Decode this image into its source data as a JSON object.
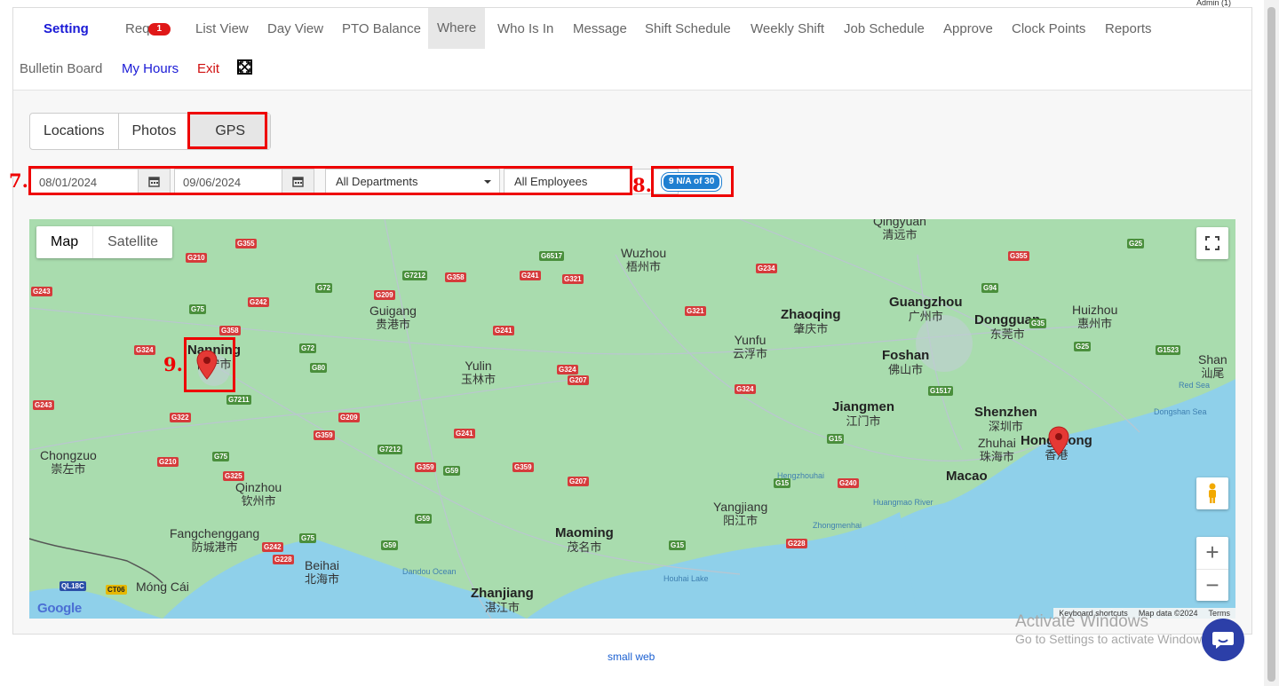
{
  "admin_label": "Admin (1)",
  "nav": {
    "row1": [
      {
        "label": "Setting",
        "style": "bold"
      },
      {
        "label": "Req",
        "badge": "1"
      },
      {
        "label": "List View"
      },
      {
        "label": "Day View"
      },
      {
        "label": "PTO Balance"
      },
      {
        "label": "Where",
        "style": "active"
      },
      {
        "label": "Who Is In"
      },
      {
        "label": "Message"
      },
      {
        "label": "Shift Schedule"
      },
      {
        "label": "Weekly Shift"
      },
      {
        "label": "Job Schedule"
      },
      {
        "label": "Approve"
      },
      {
        "label": "Clock Points"
      },
      {
        "label": "Reports"
      }
    ],
    "row2": [
      {
        "label": "Bulletin Board"
      },
      {
        "label": "My Hours",
        "style": "blue"
      },
      {
        "label": "Exit",
        "style": "red"
      }
    ],
    "expand_icon": "expand-icon"
  },
  "tabs": [
    {
      "label": "Locations"
    },
    {
      "label": "Photos"
    },
    {
      "label": "GPS",
      "active": true
    }
  ],
  "filters": {
    "start_date": "08/01/2024",
    "end_date": "09/06/2024",
    "department": "All Departments",
    "employee": "All Employees",
    "calendar_icon": "calendar-icon"
  },
  "count_badge": "9 N/A of 30",
  "annotations": {
    "filters": "7.",
    "count": "8.",
    "marker": "9."
  },
  "map": {
    "type_map": "Map",
    "type_satellite": "Satellite",
    "zoom_in": "+",
    "zoom_out": "−",
    "google": "Google",
    "footer": [
      "Keyboard shortcuts",
      "Map data ©2024",
      "Terms"
    ],
    "cities": [
      {
        "en": "Nanning",
        "zh": "南宁市"
      },
      {
        "en": "Wuzhou",
        "zh": "梧州市"
      },
      {
        "en": "Guigang",
        "zh": "贵港市"
      },
      {
        "en": "Yulin",
        "zh": "玉林市"
      },
      {
        "en": "Zhaoqing",
        "zh": "肇庆市"
      },
      {
        "en": "Guangzhou",
        "zh": "广州市"
      },
      {
        "en": "Dongguan",
        "zh": "东莞市"
      },
      {
        "en": "Huizhou",
        "zh": "惠州市"
      },
      {
        "en": "Yunfu",
        "zh": "云浮市"
      },
      {
        "en": "Foshan",
        "zh": "佛山市"
      },
      {
        "en": "Jiangmen",
        "zh": "江门市"
      },
      {
        "en": "Shenzhen",
        "zh": "深圳市"
      },
      {
        "en": "Hong Kong",
        "zh": "香港"
      },
      {
        "en": "Zhuhai",
        "zh": "珠海市"
      },
      {
        "en": "Macao",
        "zh": ""
      },
      {
        "en": "Chongzuo",
        "zh": "崇左市"
      },
      {
        "en": "Qinzhou",
        "zh": "钦州市"
      },
      {
        "en": "Fangchenggang",
        "zh": "防城港市"
      },
      {
        "en": "Beihai",
        "zh": "北海市"
      },
      {
        "en": "Maoming",
        "zh": "茂名市"
      },
      {
        "en": "Yangjiang",
        "zh": "阳江市"
      },
      {
        "en": "Zhanjiang",
        "zh": "湛江市"
      },
      {
        "en": "Qingyuan",
        "zh": "清远市"
      },
      {
        "en": "Shan",
        "zh": "汕尾"
      },
      {
        "en": "Móng Cái",
        "zh": ""
      }
    ],
    "roads": [
      "G355",
      "G210",
      "G243",
      "G72",
      "G209",
      "G7212",
      "G358",
      "G241",
      "G321",
      "G6517",
      "G234",
      "G94",
      "G355",
      "G25",
      "G242",
      "G75",
      "G358",
      "G324",
      "G72",
      "G80",
      "G321",
      "G35",
      "G241",
      "G324",
      "G207",
      "G324",
      "G1517",
      "G1523",
      "G25",
      "G322",
      "G7211",
      "G209",
      "G359",
      "G241",
      "G15",
      "G75",
      "G325",
      "G7212",
      "G359",
      "G59",
      "G359",
      "G207",
      "G15",
      "G240",
      "G210",
      "G59",
      "G242",
      "G75",
      "G59",
      "G15",
      "G228",
      "G228",
      "QL18C",
      "CT06",
      "G243"
    ],
    "seas": [
      "Red Sea",
      "Dongshan Sea",
      "Hengzhouhai",
      "Huangmao River",
      "Zhongmenhai",
      "Dandou Ocean",
      "Houhai Lake"
    ]
  },
  "footer_link": "small web",
  "watermark": {
    "line1": "Activate Windows",
    "line2": "Go to Settings to activate Windows."
  }
}
